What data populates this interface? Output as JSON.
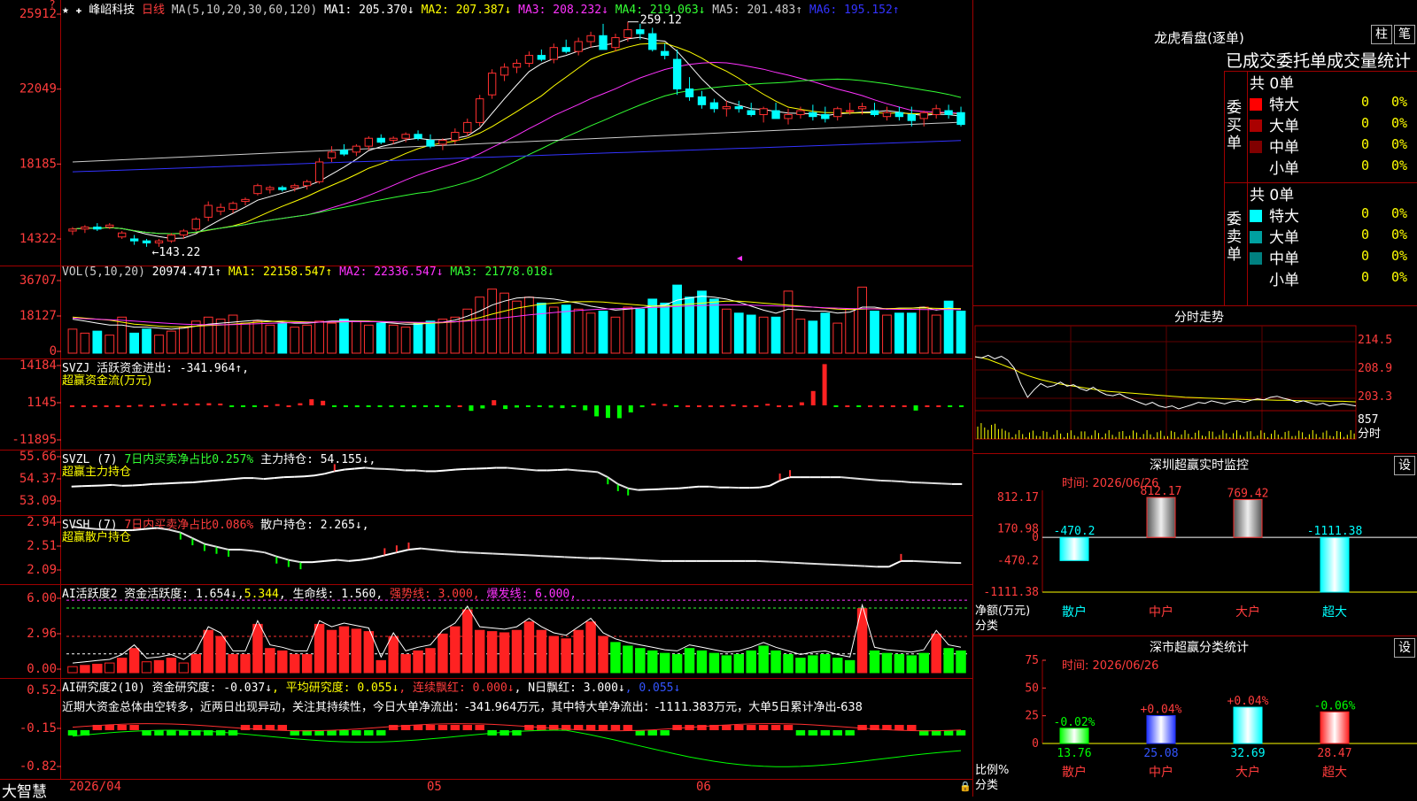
{
  "stock": {
    "name": "峰岹科技",
    "period": "日线"
  },
  "kline": {
    "star": "★",
    "ma_label": "MA(5,10,20,30,60,120)",
    "ma": [
      {
        "text": "MA1: 205.370↓",
        "color": "#ffffff"
      },
      {
        "text": "MA2: 207.387↓",
        "color": "#ffff00"
      },
      {
        "text": "MA3: 208.232↓",
        "color": "#ff33ff"
      },
      {
        "text": "MA4: 219.063↓",
        "color": "#33ff33"
      },
      {
        "text": "MA5: 201.483↑",
        "color": "#cccccc"
      },
      {
        "text": "MA6: 195.152↑",
        "color": "#3333ff"
      }
    ],
    "y_labels": [
      "25912",
      "22049",
      "18185",
      "14322"
    ],
    "high_label": "259.12",
    "low_label": "←143.22",
    "top_marker": "?",
    "ohlc": [
      [
        153,
        155,
        151,
        154
      ],
      [
        154,
        156,
        152,
        155
      ],
      [
        155,
        157,
        153,
        154
      ],
      [
        155,
        157,
        154,
        156
      ],
      [
        150,
        153,
        149,
        152
      ],
      [
        149,
        151,
        146,
        148
      ],
      [
        148,
        149,
        145,
        147
      ],
      [
        147,
        149,
        145,
        148
      ],
      [
        148,
        152,
        147,
        151
      ],
      [
        151,
        154,
        149,
        153
      ],
      [
        154,
        160,
        153,
        159
      ],
      [
        160,
        168,
        158,
        166
      ],
      [
        163,
        167,
        161,
        165
      ],
      [
        164,
        168,
        162,
        167
      ],
      [
        168,
        170,
        166,
        169
      ],
      [
        172,
        177,
        171,
        176
      ],
      [
        174,
        176,
        172,
        175
      ],
      [
        175,
        176,
        173,
        174
      ],
      [
        175,
        177,
        173,
        176
      ],
      [
        176,
        179,
        174,
        178
      ],
      [
        178,
        190,
        177,
        188
      ],
      [
        190,
        196,
        188,
        193
      ],
      [
        194,
        197,
        191,
        192
      ],
      [
        193,
        197,
        191,
        196
      ],
      [
        196,
        201,
        194,
        200
      ],
      [
        200,
        202,
        197,
        198
      ],
      [
        199,
        201,
        197,
        200
      ],
      [
        200,
        203,
        198,
        202
      ],
      [
        202,
        204,
        199,
        200
      ],
      [
        199,
        202,
        195,
        196
      ],
      [
        197,
        200,
        194,
        199
      ],
      [
        199,
        205,
        197,
        203
      ],
      [
        203,
        210,
        201,
        208
      ],
      [
        208,
        222,
        206,
        220
      ],
      [
        222,
        235,
        220,
        233
      ],
      [
        232,
        238,
        229,
        236
      ],
      [
        236,
        240,
        233,
        238
      ],
      [
        238,
        244,
        236,
        242
      ],
      [
        242,
        245,
        239,
        240
      ],
      [
        240,
        248,
        238,
        246
      ],
      [
        246,
        250,
        243,
        244
      ],
      [
        244,
        251,
        242,
        249
      ],
      [
        249,
        254,
        246,
        252
      ],
      [
        252,
        258,
        248,
        245
      ],
      [
        246,
        253,
        244,
        251
      ],
      [
        251,
        259,
        249,
        255
      ],
      [
        255,
        258,
        250,
        253
      ],
      [
        253,
        256,
        244,
        245
      ],
      [
        244,
        248,
        240,
        242
      ],
      [
        240,
        245,
        222,
        225
      ],
      [
        225,
        231,
        219,
        221
      ],
      [
        221,
        224,
        215,
        217
      ],
      [
        218,
        220,
        213,
        215
      ],
      [
        215,
        219,
        211,
        216
      ],
      [
        216,
        219,
        213,
        215
      ],
      [
        214,
        218,
        211,
        212
      ],
      [
        212,
        216,
        208,
        215
      ],
      [
        214,
        218,
        210,
        210
      ],
      [
        210,
        215,
        207,
        212
      ],
      [
        212,
        216,
        210,
        214
      ],
      [
        213,
        217,
        209,
        211
      ],
      [
        212,
        216,
        208,
        210
      ],
      [
        211,
        216,
        209,
        215
      ],
      [
        214,
        218,
        212,
        214
      ],
      [
        215,
        218,
        212,
        216
      ],
      [
        214,
        218,
        211,
        212
      ],
      [
        211,
        216,
        209,
        213
      ],
      [
        213,
        216,
        209,
        211
      ],
      [
        212,
        216,
        206,
        209
      ],
      [
        210,
        214,
        206,
        213
      ],
      [
        212,
        217,
        210,
        215
      ],
      [
        214,
        217,
        210,
        212
      ],
      [
        213,
        216,
        206,
        207
      ]
    ]
  },
  "vol": {
    "header": "VOL(5,10,20)",
    "items": [
      {
        "text": "20974.471↑",
        "color": "#ffffff"
      },
      {
        "text": "MA1: 22158.547↑",
        "color": "#ffff00"
      },
      {
        "text": "MA2: 22336.547↓",
        "color": "#ff33ff"
      },
      {
        "text": "MA3: 21778.018↓",
        "color": "#33ff33"
      }
    ],
    "y_labels": [
      "36707",
      "18127",
      "0"
    ],
    "values": [
      12000,
      10000,
      11000,
      9000,
      18000,
      10000,
      12000,
      9000,
      11000,
      13000,
      16000,
      18000,
      17000,
      19000,
      15000,
      16000,
      14000,
      15000,
      13000,
      14000,
      16000,
      15000,
      17000,
      16000,
      14000,
      15000,
      14000,
      13000,
      15000,
      16000,
      17000,
      18000,
      22000,
      28000,
      32000,
      30000,
      26000,
      28000,
      25000,
      23000,
      24000,
      22000,
      20000,
      21000,
      18000,
      23000,
      22000,
      27000,
      25000,
      34000,
      28000,
      31000,
      27000,
      22000,
      20000,
      19000,
      18000,
      18000,
      31000,
      17000,
      16000,
      20000,
      15000,
      22000,
      33000,
      21000,
      19000,
      20000,
      20000,
      23000,
      19000,
      26000,
      21000
    ],
    "ma_lines": [
      [
        17000,
        16000,
        15000,
        14000,
        14000,
        13000,
        13000,
        12500,
        12000,
        12500,
        13500,
        14500,
        15000,
        15500,
        16000,
        16500,
        16000,
        15500,
        15000,
        15000,
        15500,
        16000,
        16000,
        16000,
        16000,
        15500,
        15000,
        14500,
        14500,
        15000,
        15500,
        16500,
        18500,
        21000,
        24000,
        26000,
        27500,
        28000,
        27500,
        27000,
        26000,
        25000,
        23500,
        22500,
        21500,
        22000,
        22500,
        23500,
        24000,
        26500,
        27500,
        28500,
        28000,
        27000,
        25500,
        23500,
        21500,
        20000,
        22000,
        21500,
        21000,
        21000,
        20000,
        20500,
        23000,
        23000,
        22000,
        22500,
        22500,
        23000,
        21500,
        22500,
        22000
      ],
      [
        18000,
        17500,
        17000,
        16500,
        15500,
        14500,
        14000,
        13500,
        13200,
        13200,
        13500,
        13800,
        14000,
        14500,
        15000,
        15500,
        15800,
        16000,
        15800,
        15600,
        15500,
        15500,
        15600,
        15800,
        15900,
        15800,
        15600,
        15300,
        15000,
        15000,
        15200,
        15600,
        16500,
        17800,
        19500,
        21000,
        22500,
        23500,
        24500,
        25000,
        25500,
        25700,
        25800,
        25500,
        25000,
        24500,
        24000,
        23500,
        23500,
        24000,
        24500,
        25000,
        25500,
        26000,
        26000,
        25500,
        25000,
        24500,
        24000,
        23500,
        23000,
        22500,
        22000,
        21800,
        22000,
        22200,
        22300,
        22400,
        22500,
        22600,
        22400,
        22300,
        22300
      ],
      [
        17500,
        17200,
        17000,
        16700,
        16400,
        16000,
        15600,
        15200,
        14800,
        14500,
        14300,
        14200,
        14200,
        14300,
        14500,
        14700,
        14900,
        15100,
        15300,
        15400,
        15500,
        15600,
        15700,
        15700,
        15700,
        15700,
        15600,
        15500,
        15400,
        15400,
        15500,
        15700,
        16000,
        16500,
        17000,
        17700,
        18400,
        19100,
        19700,
        20300,
        20800,
        21300,
        21700,
        22000,
        22200,
        22400,
        22600,
        22800,
        23000,
        23300,
        23600,
        23800,
        24000,
        24100,
        24100,
        24000,
        23800,
        23600,
        23400,
        23200,
        23000,
        22700,
        22500,
        22300,
        22200,
        22100,
        22000,
        21900,
        21900,
        21800,
        21800,
        21800,
        21800
      ]
    ]
  },
  "svzj": {
    "header_prefix": "SVZJ  活跃资金进出: ",
    "header_value": "-341.964↑,",
    "subtitle": "超赢资金流(万元)",
    "y_labels": [
      "14184",
      "1145",
      "-11895"
    ],
    "values": [
      0,
      0,
      0,
      0,
      0,
      0,
      200,
      0,
      400,
      600,
      600,
      600,
      700,
      600,
      -400,
      -300,
      -200,
      0,
      400,
      0,
      700,
      2000,
      1500,
      -300,
      -300,
      -600,
      -500,
      -400,
      -300,
      -400,
      -600,
      -500,
      -200,
      -600,
      0,
      -1800,
      -1000,
      1700,
      -1200,
      -700,
      -500,
      -500,
      -700,
      -900,
      -400,
      -1600,
      -3600,
      -4100,
      -4200,
      -2300,
      -600,
      600,
      400,
      -300,
      0,
      0,
      0,
      0,
      300,
      0,
      0,
      500,
      0,
      0,
      1000,
      4700,
      13500,
      -300,
      0,
      -300,
      0,
      0,
      0,
      0,
      -1700,
      0,
      0,
      -300,
      -341
    ]
  },
  "svzl": {
    "header_prefix": "SVZL (7) ",
    "header_green": "7日内买卖净占比0.257%",
    "header_rest": " 主力持仓: 54.155↓,",
    "subtitle": "超赢主力持仓",
    "y_labels": [
      "55.66",
      "54.37",
      "53.09"
    ],
    "values": [
      54.05,
      54.08,
      54.1,
      54.12,
      54.15,
      54.1,
      54.12,
      54.15,
      54.2,
      54.22,
      54.25,
      54.28,
      54.3,
      54.35,
      54.4,
      54.45,
      54.5,
      54.55,
      54.55,
      54.5,
      54.55,
      54.6,
      54.62,
      54.65,
      54.7,
      54.8,
      54.95,
      55.05,
      55.1,
      55.15,
      55.1,
      55.08,
      55.05,
      55.0,
      55.0,
      54.95,
      54.95,
      55.0,
      55.05,
      55.08,
      55.1,
      55.12,
      55.15,
      55.15,
      55.1,
      55.05,
      55.0,
      55.0,
      55.02,
      55.05,
      55.0,
      54.95,
      54.9,
      54.6,
      54.2,
      53.95,
      53.85,
      53.88,
      53.9,
      53.93,
      53.95,
      54.0,
      54.05,
      54.05,
      54.0,
      54.0,
      53.98,
      53.98,
      54.0,
      54.1,
      54.4,
      54.6,
      54.6,
      54.6,
      54.6,
      54.6,
      54.6,
      54.55,
      54.5,
      54.45,
      54.4,
      54.38,
      54.35,
      54.3,
      54.28,
      54.25,
      54.23,
      54.2,
      54.2
    ]
  },
  "svsh": {
    "header_prefix": "SVSH (7) ",
    "header_red": "7日内买卖净占比0.086%",
    "header_rest": " 散户持仓: 2.265↓,",
    "subtitle": "超赢散户持仓",
    "y_labels": [
      "2.94",
      "2.51",
      "2.09"
    ],
    "values": [
      2.9,
      2.88,
      2.86,
      2.85,
      2.84,
      2.84,
      2.86,
      2.88,
      2.85,
      2.8,
      2.7,
      2.6,
      2.55,
      2.5,
      2.5,
      2.48,
      2.45,
      2.38,
      2.32,
      2.28,
      2.28,
      2.3,
      2.32,
      2.3,
      2.32,
      2.35,
      2.4,
      2.45,
      2.5,
      2.52,
      2.5,
      2.48,
      2.46,
      2.45,
      2.44,
      2.43,
      2.42,
      2.41,
      2.4,
      2.39,
      2.38,
      2.37,
      2.36,
      2.35,
      2.35,
      2.34,
      2.33,
      2.32,
      2.31,
      2.3,
      2.3,
      2.3,
      2.3,
      2.3,
      2.3,
      2.3,
      2.3,
      2.3,
      2.29,
      2.28,
      2.27,
      2.26,
      2.25,
      2.24,
      2.23,
      2.22,
      2.21,
      2.2,
      2.2,
      2.3,
      2.3,
      2.29,
      2.28,
      2.27,
      2.265
    ]
  },
  "ai1": {
    "header_prefix": "AI活跃度2 资金活跃度: 1.654↓",
    "header_yellow": "5.344",
    "header_rest": ", 生命线: 1.560,",
    "header_red": " 强势线: 3.000,",
    "header_mag": " 爆发线: 6.000,",
    "y_labels": [
      "6.00",
      "2.96",
      "0.00"
    ],
    "values": [
      0.5,
      0.6,
      0.7,
      0.8,
      1.2,
      2.0,
      0.9,
      1.0,
      1.2,
      0.8,
      1.5,
      3.5,
      3.0,
      1.5,
      1.5,
      4.0,
      2.0,
      1.8,
      1.5,
      1.5,
      4.0,
      3.5,
      3.8,
      3.6,
      3.4,
      1.0,
      3.0,
      1.5,
      1.8,
      2.0,
      3.2,
      3.8,
      5.2,
      3.5,
      3.4,
      3.3,
      3.5,
      4.2,
      3.5,
      3.0,
      2.8,
      3.5,
      4.2,
      3.0,
      2.5,
      2.2,
      2.0,
      1.8,
      1.6,
      1.5,
      2.0,
      1.8,
      1.6,
      1.4,
      1.5,
      1.8,
      2.2,
      1.8,
      1.5,
      1.2,
      1.4,
      1.5,
      1.2,
      1.0,
      5.3,
      1.8,
      1.6,
      1.5,
      1.4,
      1.6,
      3.2,
      2.0,
      1.8
    ],
    "green_from": 41
  },
  "ai2": {
    "header_prefix": "AI研究度2(10) 资金研究度: -0.037↓",
    "header_yellow": ", 平均研究度: 0.055↓",
    "header_red": ", 连续飘红: 0.000↓",
    "header_white": ", N日飘红: 3.000↓",
    "header_blue": ", 0.055↓",
    "y_labels": [
      "0.52",
      "-0.15",
      "-0.82"
    ],
    "summary": "近期大资金总体由空转多，近两日出现异动，关注其持续性，今日大单净流出：-341.964万元，其中特大单净流出：-1111.383万元，大单5日累计净出-638"
  },
  "bottom": {
    "brand": "大智慧",
    "date1": "2026/04",
    "date2": "05",
    "date3": "06"
  },
  "lhkp": {
    "title": "龙虎看盘(逐单)",
    "tab1": "柱",
    "tab2": "笔",
    "header": "已成交委托单成交量统计",
    "buy_label": "委买单",
    "sell_label": "委卖单",
    "buy_total": "共 0单",
    "sell_total": "共 0单",
    "buy_rows": [
      {
        "label": "特大",
        "count": "0",
        "pct": "0%",
        "color": "#ff0000"
      },
      {
        "label": "大单",
        "count": "0",
        "pct": "0%",
        "color": "#aa0000"
      },
      {
        "label": "中单",
        "count": "0",
        "pct": "0%",
        "color": "#800000"
      },
      {
        "label": "小单",
        "count": "0",
        "pct": "0%",
        "color": "#000000"
      }
    ],
    "sell_rows": [
      {
        "label": "特大",
        "count": "0",
        "pct": "0%",
        "color": "#00ffff"
      },
      {
        "label": "大单",
        "count": "0",
        "pct": "0%",
        "color": "#00a0a0"
      },
      {
        "label": "中单",
        "count": "0",
        "pct": "0%",
        "color": "#008080"
      },
      {
        "label": "小单",
        "count": "0",
        "pct": "0%",
        "color": "#000000"
      }
    ]
  },
  "fenshi": {
    "title": "分时走势",
    "y_labels": [
      "214.5",
      "208.9",
      "203.3"
    ],
    "vol_labels": [
      "857",
      "分时"
    ],
    "price": [
      211.5,
      211.3,
      211.8,
      211.1,
      211.6,
      210.8,
      209.2,
      206.0,
      203.5,
      205.0,
      206.2,
      205.5,
      205.8,
      206.5,
      205.7,
      206.0,
      205.2,
      204.8,
      205.5,
      204.6,
      204.0,
      203.8,
      204.2,
      203.5,
      203.0,
      202.5,
      202.0,
      202.5,
      201.8,
      201.5,
      201.8,
      201.2,
      201.6,
      202.0,
      202.5,
      202.3,
      202.8,
      202.5,
      202.2,
      202.6,
      202.8,
      202.5,
      202.9,
      203.2,
      203.0,
      203.5,
      203.7,
      203.3,
      203.0,
      202.5,
      202.8,
      202.4,
      202.0,
      202.3,
      201.8,
      202.0,
      202.2,
      202.0,
      201.8
    ],
    "avg": [
      211.5,
      211.3,
      211.0,
      210.5,
      210.0,
      209.5,
      209.0,
      208.3,
      207.8,
      207.4,
      207.0,
      206.7,
      206.4,
      206.1,
      205.9,
      205.7,
      205.5,
      205.3,
      205.1,
      204.9,
      204.7,
      204.6,
      204.5,
      204.4,
      204.3,
      204.2,
      204.1,
      204.0,
      203.9,
      203.8,
      203.7,
      203.6,
      203.5,
      203.45,
      203.4,
      203.35,
      203.3,
      203.25,
      203.2,
      203.15,
      203.1,
      203.05,
      203.0,
      203.0,
      203.0,
      202.95,
      202.9,
      202.9,
      202.9,
      202.85,
      202.8,
      202.8,
      202.8,
      202.75,
      202.7,
      202.7,
      202.7,
      202.65,
      202.6
    ]
  },
  "szjk": {
    "title": "深圳超赢实时监控",
    "btn": "设",
    "time": "时间: 2026/06/26",
    "y_labels": [
      "812.17",
      "170.98",
      "0",
      "-470.2",
      "-1111.38"
    ],
    "bars": [
      {
        "cat": "散户",
        "value": -470.2,
        "label": "-470.2"
      },
      {
        "cat": "中户",
        "value": 812.17,
        "label": "812.17"
      },
      {
        "cat": "大户",
        "value": 769.42,
        "label": "769.42"
      },
      {
        "cat": "超大",
        "value": -1111.38,
        "label": "-1111.38"
      }
    ],
    "ylabel1": "净额(万元)",
    "ylabel2": "分类"
  },
  "fltj": {
    "title": "深市超赢分类统计",
    "btn": "设",
    "time": "时间: 2026/06/26",
    "y_labels": [
      "75",
      "50",
      "25",
      "0"
    ],
    "bars": [
      {
        "cat": "散户",
        "value": 13.76,
        "chg": "-0.02%",
        "label": "13.76",
        "color": "#00ff00"
      },
      {
        "cat": "中户",
        "value": 25.08,
        "chg": "+0.04%",
        "label": "25.08",
        "color": "#2233ff"
      },
      {
        "cat": "大户",
        "value": 32.69,
        "chg": "+0.04%",
        "label": "32.69",
        "color": "#00ffff"
      },
      {
        "cat": "超大",
        "value": 28.47,
        "chg": "-0.06%",
        "label": "28.47",
        "color": "#ff2222"
      }
    ],
    "ylabel1": "比例%",
    "ylabel2": "分类"
  }
}
